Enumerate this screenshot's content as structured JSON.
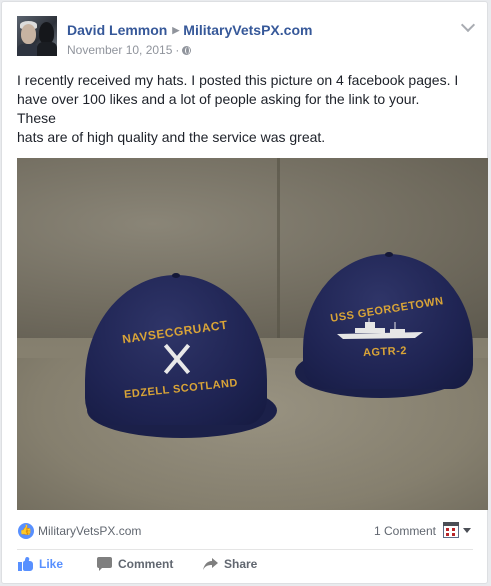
{
  "post": {
    "author": "David Lemmon",
    "target_page": "MilitaryVetsPX.com",
    "date": "November 10, 2015",
    "separator": "·",
    "text_lines": [
      "I recently received my hats. I posted this picture on 4 facebook pages. I",
      "have over 100 likes and a lot of people asking for the link to your.",
      "These",
      "hats are of high quality and the service was great."
    ]
  },
  "photo": {
    "hat_left": {
      "line1": "NAVSECGRUACT",
      "line2": "EDZELL SCOTLAND"
    },
    "hat_right": {
      "line1": "USS GEORGETOWN",
      "line2": "AGTR-2"
    }
  },
  "footer": {
    "likes_by": "MilitaryVetsPX.com",
    "comments_count": "1 Comment"
  },
  "actions": {
    "like": "Like",
    "comment": "Comment",
    "share": "Share"
  },
  "colors": {
    "link_blue": "#365899",
    "like_blue": "#5890ff",
    "muted_gray": "#90949c",
    "cap_navy": "#1f2453",
    "embroidery_gold": "#d9a437"
  },
  "icons": {
    "privacy": "globe-icon",
    "menu": "chevron-down-icon",
    "reaction": "like-reaction-icon",
    "view_toggle": "view-switcher-icon",
    "like": "thumbs-up-icon",
    "comment": "comment-bubble-icon",
    "share": "share-arrow-icon"
  }
}
